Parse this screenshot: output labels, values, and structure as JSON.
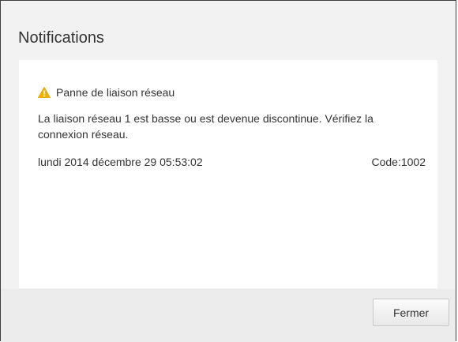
{
  "dialog": {
    "title": "Notifications",
    "close_label": "Fermer"
  },
  "notification": {
    "icon": "warning-icon",
    "icon_color": "#f0b400",
    "heading": "Panne de liaison réseau",
    "message": "La liaison réseau 1 est basse ou est devenue discontinue. Vérifiez la connexion réseau.",
    "timestamp": "lundi 2014 décembre 29 05:53:02",
    "code": "Code:1002"
  }
}
